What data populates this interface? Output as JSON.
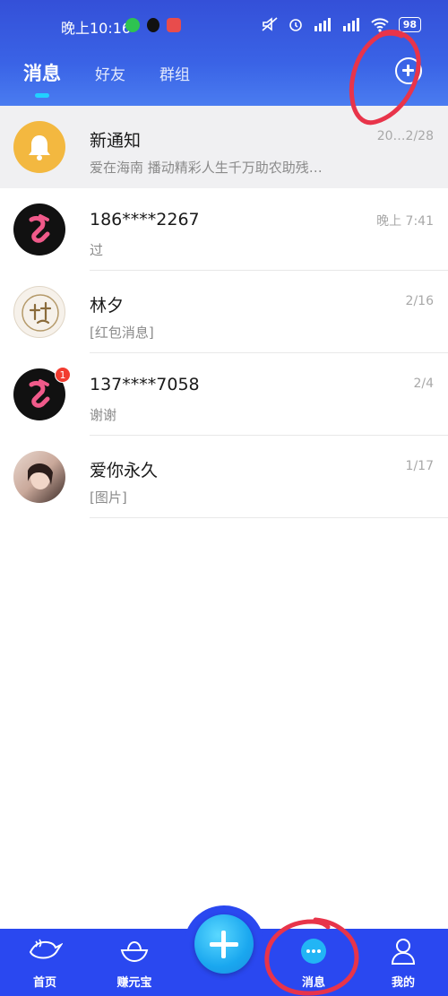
{
  "status_bar": {
    "time": "晚上10:16",
    "battery": "98"
  },
  "tabs": [
    {
      "label": "消息",
      "active": true
    },
    {
      "label": "好友",
      "active": false
    },
    {
      "label": "群组",
      "active": false
    }
  ],
  "conversations": [
    {
      "name": "新通知",
      "preview": "爱在海南 播动精彩人生千万助农助残…",
      "time": "20…2/28",
      "avatar": "bell-icon",
      "badge": ""
    },
    {
      "name": "186****2267",
      "preview": "过",
      "time": "晚上 7:41",
      "avatar": "app-logo",
      "badge": ""
    },
    {
      "name": "林夕",
      "preview": "[红包消息]",
      "time": "2/16",
      "avatar": "calligraphy-avatar",
      "badge": ""
    },
    {
      "name": "137****7058",
      "preview": "谢谢",
      "time": "2/4",
      "avatar": "app-logo",
      "badge": "1"
    },
    {
      "name": "爱你永久",
      "preview": "[图片]",
      "time": "1/17",
      "avatar": "photo-avatar",
      "badge": ""
    }
  ],
  "bottom_nav": [
    {
      "label": "首页",
      "icon": "whale-icon"
    },
    {
      "label": "赚元宝",
      "icon": "ingot-icon"
    },
    {
      "label": "",
      "icon": "plus-icon"
    },
    {
      "label": "消息",
      "icon": "chat-bubble-icon"
    },
    {
      "label": "我的",
      "icon": "person-icon"
    }
  ],
  "colors": {
    "header": "#3a63e6",
    "nav": "#2a48f0",
    "accent": "#21d1ff",
    "badge": "#f23b2f",
    "annotation": "#e8344a"
  }
}
